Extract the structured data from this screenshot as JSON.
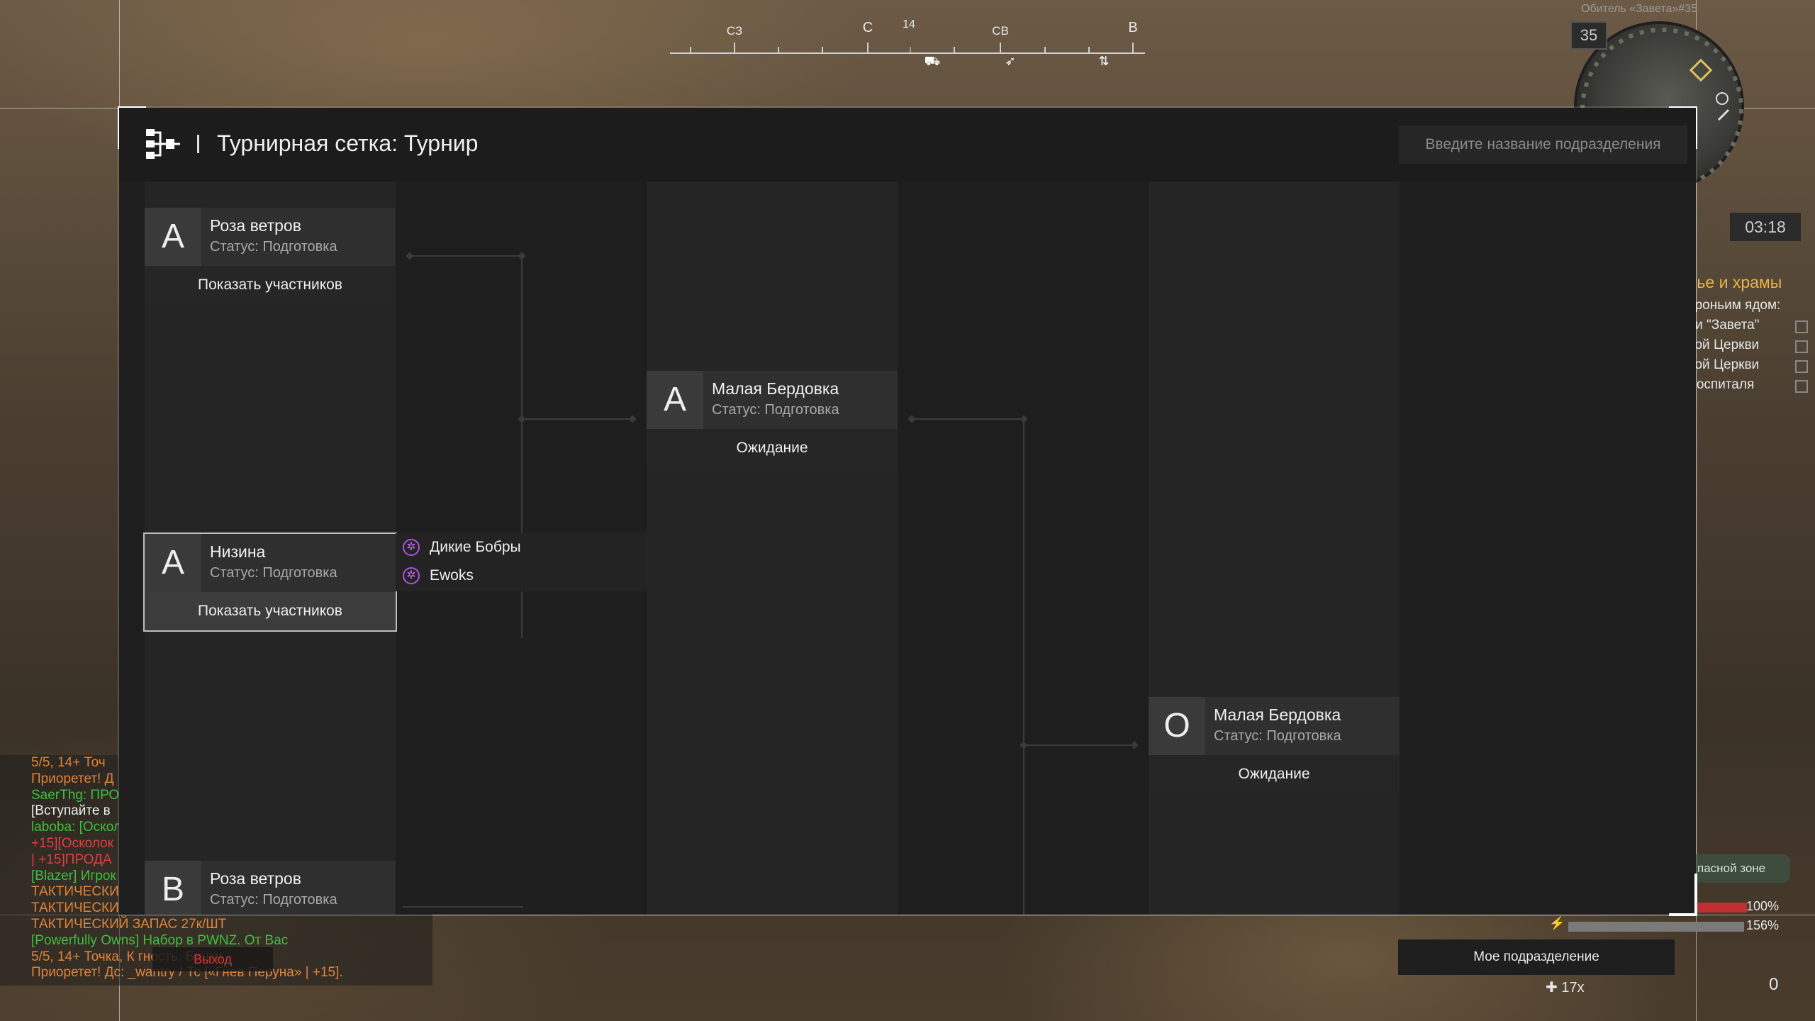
{
  "compass": {
    "heading": "14",
    "labels": [
      {
        "text": "СЗ"
      },
      {
        "text": "С"
      },
      {
        "text": "СВ"
      },
      {
        "text": "В"
      }
    ],
    "markers": [
      "⛟",
      "➶",
      "⇅"
    ]
  },
  "minimap": {
    "title": "Обитель «Завета»#35",
    "level": "35",
    "time": "03:18"
  },
  "quest": {
    "title": "лье и храмы",
    "items": [
      "ороньим ядом:",
      "ли \"Завета\"",
      "ной Церкви",
      "ной Церкви",
      "-госпиталя"
    ]
  },
  "hud": {
    "danger_zone": "пасной зоне",
    "bar1": "100%",
    "bar2": "156%",
    "my_unit": "Мое подразделение",
    "ammo": "17x",
    "count": "0"
  },
  "chat": {
    "lines": [
      {
        "text": "5/5, 14+ Точ",
        "color": "#e0843a"
      },
      {
        "text": "Приоретет! Д",
        "color": "#e0843a"
      },
      {
        "text": "SaerThg: ПРО",
        "color": "#3fbf3f"
      },
      {
        "text": "[Вступайте в",
        "color": "#f0f0f0"
      },
      {
        "text": "laboba: [Оскол",
        "color": "#3fbf3f"
      },
      {
        "text": "+15][Осколок",
        "color": "#e04040"
      },
      {
        "text": " | +15]ПРОДА",
        "color": "#e04040"
      },
      {
        "text": "[Blazer] Игрок",
        "color": "#3fbf3f"
      },
      {
        "text": "ТАКТИЧЕСКИ",
        "color": "#e0843a"
      },
      {
        "text": "ТАКТИЧЕСКИ",
        "color": "#e0843a"
      },
      {
        "text": "ТАКТИЧЕСКИЙ ЗАПАС 27к/ШТ",
        "color": "#e0843a"
      },
      {
        "text": "[Powerfully Owns] Набор в PWNZ. От Вас",
        "color": "#3fbf3f"
      },
      {
        "text": "5/5, 14+ Точка, К        гность. Банки",
        "color": "#e0843a"
      },
      {
        "text": "Приоретет! Дс: _wantry / Тс [«Гнев Перуна» | +15].",
        "color": "#e0843a"
      }
    ],
    "exit": "Выход"
  },
  "panel": {
    "title": "Турнирная сетка: Турнир",
    "search_placeholder": "Введите название подразделения"
  },
  "bracket": {
    "cards": [
      {
        "letter": "А",
        "name": "Роза ветров",
        "status": "Статус: Подготовка",
        "button": "Показать участников"
      },
      {
        "letter": "А",
        "name": "Низина",
        "status": "Статус: Подготовка",
        "button": "Показать участников"
      },
      {
        "letter": "В",
        "name": "Роза ветров",
        "status": "Статус: Подготовка",
        "button": ""
      },
      {
        "letter": "А",
        "name": "Малая Бердовка",
        "status": "Статус: Подготовка",
        "button": "Ожидание"
      },
      {
        "letter": "О",
        "name": "Малая Бердовка",
        "status": "Статус: Подготовка",
        "button": "Ожидание"
      }
    ],
    "members": [
      "Дикие Бобры",
      "Ewoks"
    ]
  }
}
